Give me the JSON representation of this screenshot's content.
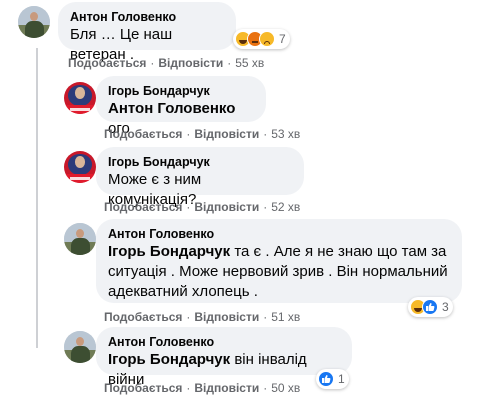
{
  "comments": [
    {
      "author": "Антон Головенко",
      "text": "Бля … Це наш ветеран .",
      "like_label": "Подобається",
      "reply_label": "Відповісти",
      "time": "55 хв",
      "reactions_count": "7",
      "reactions": [
        "haha",
        "angry",
        "sad"
      ]
    },
    {
      "author": "Ігорь Бондарчук",
      "mention": "Антон Головенко",
      "text": "ого",
      "like_label": "Подобається",
      "reply_label": "Відповісти",
      "time": "53 хв"
    },
    {
      "author": "Ігорь Бондарчук",
      "text": "Може є з ним комунікація?",
      "like_label": "Подобається",
      "reply_label": "Відповісти",
      "time": "52 хв"
    },
    {
      "author": "Антон Головенко",
      "mention": "Ігорь Бондарчук",
      "text_lines": [
        "та є . Але я не знаю що там за",
        "ситуація . Може нервовий зрив . Він нормальний",
        "адекватний хлопець ."
      ],
      "like_label": "Подобається",
      "reply_label": "Відповісти",
      "time": "51 хв",
      "reactions_count": "3",
      "reactions": [
        "haha",
        "like"
      ]
    },
    {
      "author": "Антон Головенко",
      "mention": "Ігорь Бондарчук",
      "text": "він інвалід війни",
      "like_label": "Подобається",
      "reply_label": "Відповісти",
      "time": "50 хв",
      "reactions_count": "1",
      "reactions": [
        "like"
      ]
    }
  ],
  "dot": "·"
}
